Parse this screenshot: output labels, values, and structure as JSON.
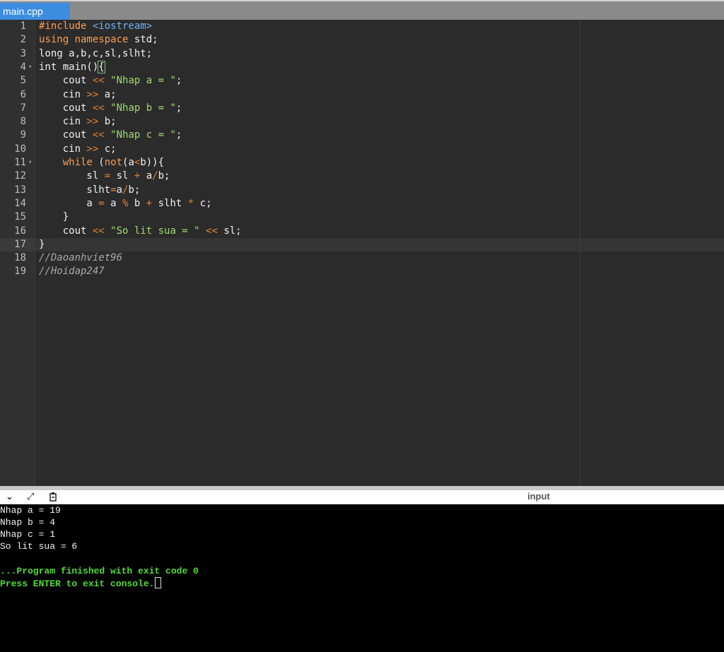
{
  "tab": {
    "label": "main.cpp"
  },
  "editor": {
    "line_numbers": [
      "1",
      "2",
      "3",
      "4",
      "5",
      "6",
      "7",
      "8",
      "9",
      "10",
      "11",
      "12",
      "13",
      "14",
      "15",
      "16",
      "17",
      "18",
      "19"
    ],
    "fold_markers": [
      "4",
      "11"
    ],
    "code": {
      "l1_a": "#include ",
      "l1_b": "<iostream>",
      "l2_a": "using namespace",
      "l2_b": " std;",
      "l3": "long a,b,c,sl,slht;",
      "l4_a": "int main()",
      "l4_b": "{",
      "l5_a": "    cout ",
      "l5_b": "<<",
      "l5_c": " ",
      "l5_d": "\"Nhap a = \"",
      "l5_e": ";",
      "l6_a": "    cin ",
      "l6_b": ">>",
      "l6_c": " a;",
      "l7_a": "    cout ",
      "l7_b": "<<",
      "l7_c": " ",
      "l7_d": "\"Nhap b = \"",
      "l7_e": ";",
      "l8_a": "    cin ",
      "l8_b": ">>",
      "l8_c": " b;",
      "l9_a": "    cout ",
      "l9_b": "<<",
      "l9_c": " ",
      "l9_d": "\"Nhap c = \"",
      "l9_e": ";",
      "l10_a": "    cin ",
      "l10_b": ">>",
      "l10_c": " c;",
      "l11_a": "    ",
      "l11_b": "while",
      "l11_c": " (",
      "l11_d": "not",
      "l11_e": "(a",
      "l11_f": "<",
      "l11_g": "b)){",
      "l12_a": "        sl ",
      "l12_b": "=",
      "l12_c": " sl ",
      "l12_d": "+",
      "l12_e": " a",
      "l12_f": "/",
      "l12_g": "b;",
      "l13_a": "        slht",
      "l13_b": "=",
      "l13_c": "a",
      "l13_d": "/",
      "l13_e": "b;",
      "l14_a": "        a ",
      "l14_b": "=",
      "l14_c": " a ",
      "l14_d": "%",
      "l14_e": " b ",
      "l14_f": "+",
      "l14_g": " slht ",
      "l14_h": "*",
      "l14_i": " c;",
      "l15": "    }",
      "l16_a": "    cout ",
      "l16_b": "<<",
      "l16_c": " ",
      "l16_d": "\"So lit sua = \"",
      "l16_e": " ",
      "l16_f": "<<",
      "l16_g": " sl;",
      "l17": "}",
      "l18": "//Daoanhviet96",
      "l19": "//Hoidap247"
    }
  },
  "console": {
    "header": {
      "input_label": "input",
      "collapse_icon": "chevron-down-icon",
      "expand_icon": "expand-arrows-icon",
      "copy_icon": "clipboard-icon"
    },
    "output_lines": [
      "Nhap a = 19",
      "Nhap b = 4",
      "Nhap c = 1",
      "So lit sua = 6",
      "",
      "...Program finished with exit code 0",
      "Press ENTER to exit console."
    ]
  },
  "colors": {
    "keyword": "#ff9d4d",
    "string": "#a0db6c",
    "include": "#6fb2f2",
    "comment": "#a9a9a9",
    "tab_active": "#3c8de0",
    "console_green": "#4fdc33"
  }
}
